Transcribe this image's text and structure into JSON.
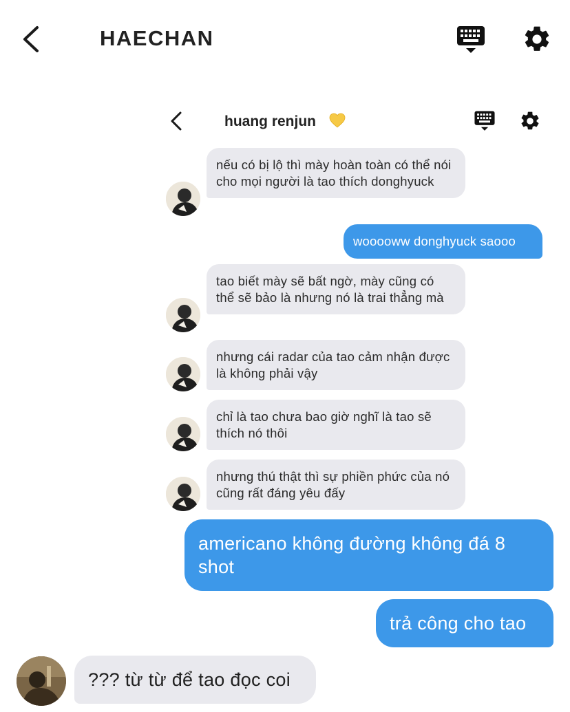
{
  "outer_header": {
    "title": "HAECHAN",
    "back_icon": "chevron-left-icon",
    "keyboard_icon": "keyboard-icon",
    "settings_icon": "gear-icon"
  },
  "inner_header": {
    "title": "huang renjun",
    "heart_icon": "yellow-heart-icon",
    "heart_color": "#f6c945"
  },
  "colors": {
    "outgoing_bubble": "#3d98e9",
    "incoming_bubble": "#e9e9ee"
  },
  "inner_messages": [
    {
      "text": "nếu có bị lộ thì mày hoàn toàn có thể nói cho mọi người là tao thích donghyuck"
    },
    {
      "text": "wooooww donghyuck saooo"
    },
    {
      "text": "tao biết mày sẽ bất ngờ, mày cũng có thể sẽ bảo là nhưng nó là trai thẳng mà"
    },
    {
      "text": "nhưng cái radar của tao cảm nhận được là không phải vậy"
    },
    {
      "text": "chỉ là tao chưa bao giờ nghĩ là tao sẽ thích nó thôi"
    },
    {
      "text": "nhưng thú thật thì sự phiền phức của nó cũng rất đáng yêu đấy"
    }
  ],
  "outer_messages": [
    {
      "text": "americano không đường không đá 8 shot"
    },
    {
      "text": "trả công cho tao"
    },
    {
      "text": "??? từ từ để tao đọc coi"
    }
  ]
}
